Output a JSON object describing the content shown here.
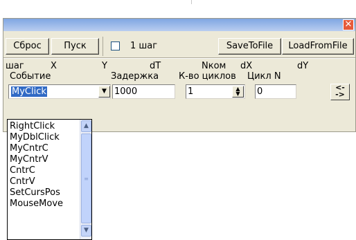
{
  "window": {
    "close_glyph": "✕"
  },
  "toolbar": {
    "reset_label": "Сброс",
    "start_label": "Пуск",
    "step_label": "1 шаг",
    "save_label": "SaveToFile",
    "load_label": "LoadFromFile"
  },
  "headers": {
    "row1": {
      "step": "шаг",
      "x": "X",
      "y": "Y",
      "dt": "dT",
      "ncom": "Nком",
      "dx": "dX",
      "dy": "dY"
    },
    "row2": {
      "event": "Событие",
      "delay": "Задержка",
      "cycles": "К-во циклов",
      "cycle_n": "Цикл N"
    }
  },
  "fields": {
    "event_value": "MyClick",
    "delay_value": "1000",
    "cycles_value": "1",
    "cycle_n_value": "0"
  },
  "arrows": {
    "left": "<-",
    "right": "->"
  },
  "dropdown": {
    "items": [
      "RightClick",
      "MyDblClick",
      "MyCntrC",
      "MyCntrV",
      "CntrC",
      "CntrV",
      "SetCursPos",
      "MouseMove"
    ]
  },
  "icons": {
    "close": "close-icon",
    "dropdown": "chevron-down-icon",
    "spin": "spin-updown-icon",
    "scroll_up": "chevron-up-icon",
    "scroll_down": "chevron-down-icon"
  }
}
